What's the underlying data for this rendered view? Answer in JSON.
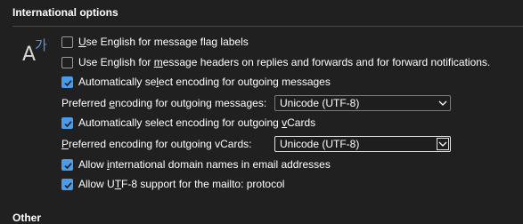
{
  "section": {
    "title": "International options"
  },
  "options": [
    {
      "pre": "",
      "u": "U",
      "post": "se English for message flag labels",
      "checked": false
    },
    {
      "pre": "Use English for ",
      "u": "m",
      "post": "essage headers on replies and forwards and for forward notifications.",
      "checked": false
    },
    {
      "pre": "Automatically se",
      "u": "l",
      "post": "ect encoding for outgoing messages",
      "checked": true
    }
  ],
  "encoding_messages": {
    "label_pre": "Preferred ",
    "label_u": "e",
    "label_post": "ncoding for outgoing messages:",
    "value": "Unicode (UTF-8)"
  },
  "vcards_auto": {
    "pre": "Automatically select encoding for outgoing ",
    "u": "v",
    "post": "Cards",
    "checked": true
  },
  "encoding_vcards": {
    "label_pre": "",
    "label_u": "P",
    "label_post": "referred encoding for outgoing vCards:",
    "value": "Unicode (UTF-8)"
  },
  "options2": [
    {
      "pre": "Allow ",
      "u": "i",
      "post": "nternational domain names in email addresses",
      "checked": true
    },
    {
      "pre": "Allow U",
      "u": "T",
      "post": "F-8 support for the mailto: protocol",
      "checked": true
    }
  ],
  "other": {
    "title": "Other"
  },
  "icon": {
    "name": "language-icon",
    "glyph_latin": "A",
    "glyph_hangul": "가"
  }
}
